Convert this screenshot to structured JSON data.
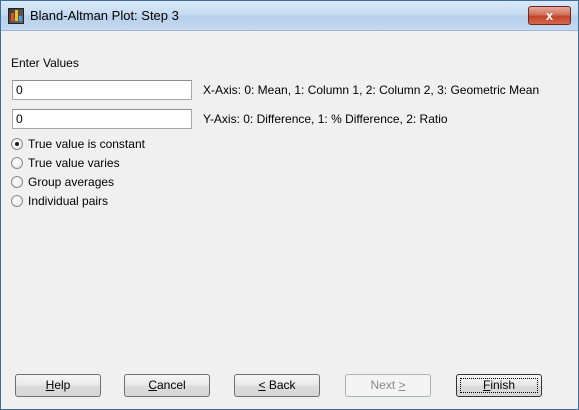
{
  "window": {
    "title": "Bland-Altman Plot: Step 3",
    "close_label": "x"
  },
  "form": {
    "section_label": "Enter Values",
    "x_axis_value": "0",
    "x_axis_hint": "X-Axis: 0: Mean, 1: Column 1, 2: Column 2, 3: Geometric Mean",
    "y_axis_value": "0",
    "y_axis_hint": "Y-Axis: 0: Difference, 1: % Difference, 2: Ratio"
  },
  "options": [
    {
      "label": "True value is constant",
      "selected": true
    },
    {
      "label": "True value varies",
      "selected": false
    },
    {
      "label": "Group averages",
      "selected": false
    },
    {
      "label": "Individual pairs",
      "selected": false
    }
  ],
  "buttons": {
    "help": {
      "accel": "H",
      "rest": "elp"
    },
    "cancel": {
      "accel": "C",
      "rest": "ancel"
    },
    "back": {
      "accel": "<",
      "rest": " Back"
    },
    "next": {
      "prefix": "Next ",
      "accel": ">"
    },
    "finish": {
      "accel": "F",
      "rest": "inish"
    }
  }
}
